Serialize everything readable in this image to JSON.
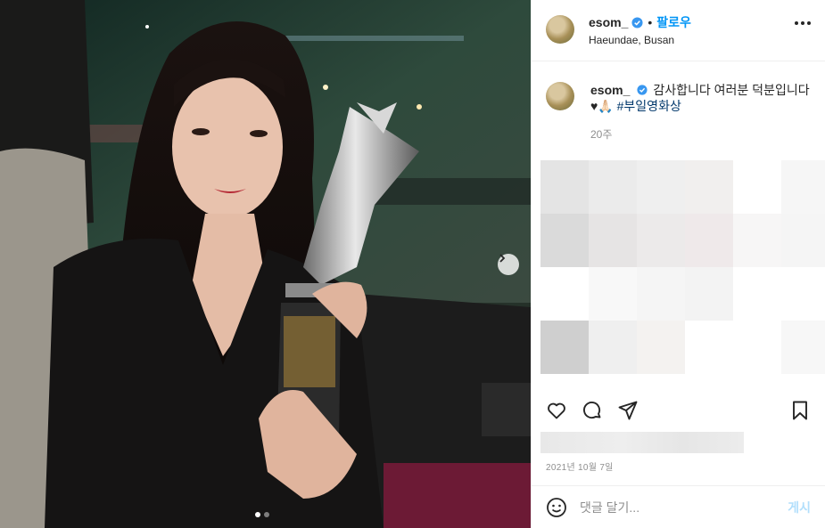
{
  "post": {
    "photo": {
      "subject": "woman holding silver trophy in car",
      "slide_count": 2,
      "active_slide": 1
    },
    "author": {
      "username": "esom_",
      "verified": true,
      "follow_label": "팔로우",
      "separator": "•",
      "location": "Haeundae, Busan"
    },
    "caption": {
      "username": "esom_",
      "text": "감사합니다 여러분 덕분입니다 ♥🙏🏻 ",
      "hashtag": "#부일영화상",
      "time": "20주"
    },
    "date": "2021년 10월 7일",
    "comment_box": {
      "placeholder": "댓글 달기...",
      "post_label": "게시"
    }
  },
  "icons": {
    "more": "more-options-icon",
    "like": "heart-icon",
    "comment": "comment-icon",
    "share": "paper-plane-icon",
    "save": "bookmark-icon",
    "emoji": "smiley-icon",
    "verified": "verified-badge-icon",
    "next": "chevron-right-icon"
  },
  "colors": {
    "accent": "#0095f6",
    "hashtag": "#00376b",
    "muted": "#8e8e8e",
    "verified": "#3897f0",
    "post_disabled": "#b2dffc"
  }
}
